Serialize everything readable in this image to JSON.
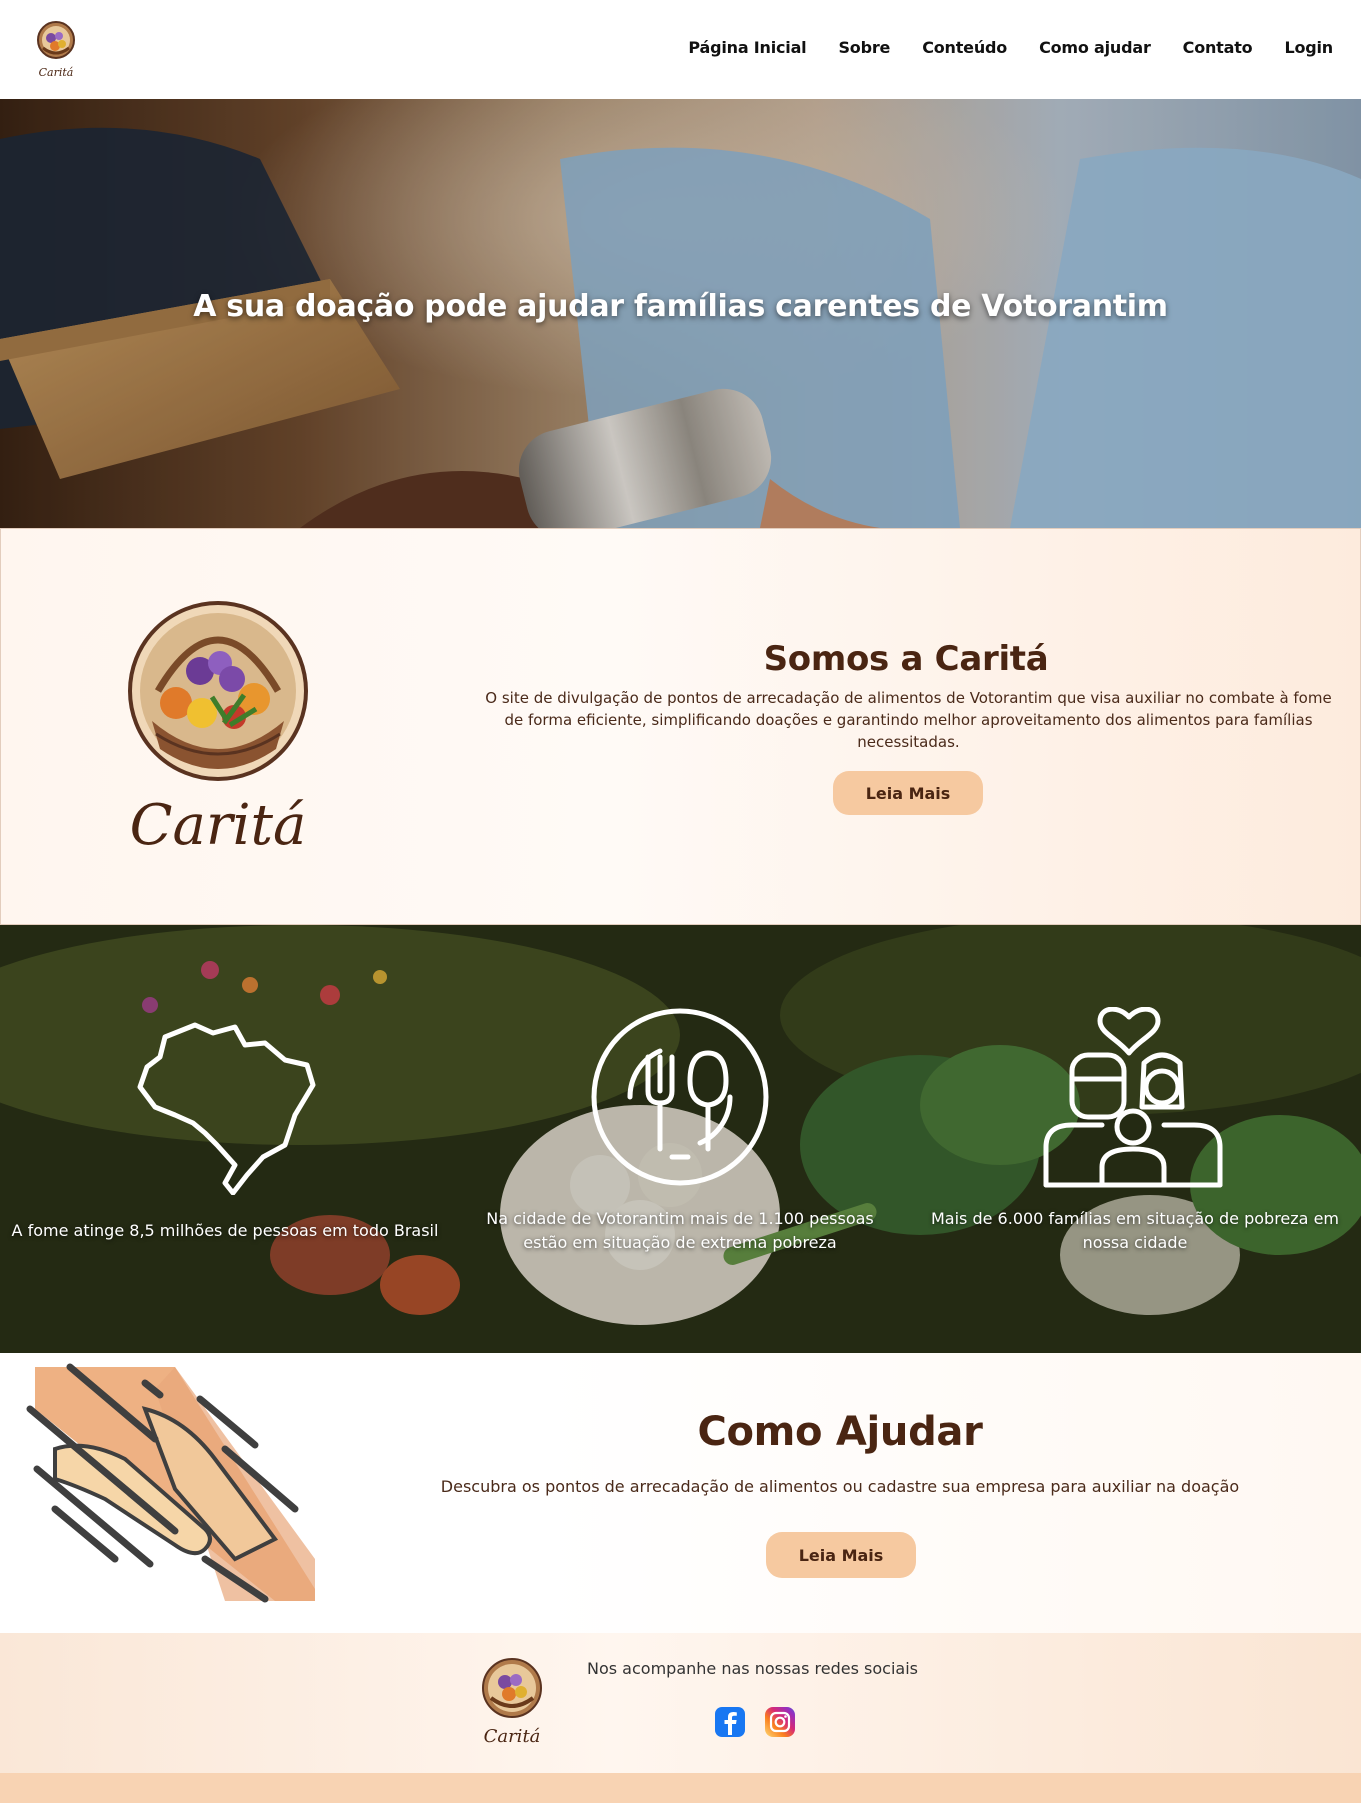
{
  "brand": {
    "name": "Caritá"
  },
  "nav": {
    "items": [
      "Página Inicial",
      "Sobre",
      "Conteúdo",
      "Como ajudar",
      "Contato",
      "Login"
    ]
  },
  "hero": {
    "title": "A sua doação pode ajudar famílias carentes de Votorantim"
  },
  "about": {
    "title": "Somos a Caritá",
    "text": "O site de divulgação de pontos de arrecadação de alimentos de Votorantim que visa auxiliar no combate à fome de forma eficiente, simplificando doações e garantindo melhor aproveitamento dos alimentos para famílias necessitadas.",
    "button": "Leia Mais"
  },
  "stats": [
    {
      "icon": "brazil-map-icon",
      "text": "A fome atinge 8,5 milhões de pessoas em todo Brasil"
    },
    {
      "icon": "plate-cutlery-icon",
      "text": "Na cidade de Votorantim mais de 1.100 pessoas estão em situação de extrema pobreza"
    },
    {
      "icon": "family-heart-icon",
      "text": "Mais de 6.000 famílias em situação de pobreza em nossa cidade"
    }
  ],
  "help": {
    "title": "Como Ajudar",
    "text": "Descubra os pontos de arrecadação de alimentos ou cadastre sua empresa para auxiliar na doação",
    "button": "Leia Mais"
  },
  "footer": {
    "social_text": "Nos acompanhe nas nossas redes sociais",
    "social": [
      "facebook-icon",
      "instagram-icon"
    ]
  },
  "colors": {
    "accent": "#f6c9a0",
    "heading": "#4a2512",
    "bottom_bar": "#f8d3b3"
  }
}
